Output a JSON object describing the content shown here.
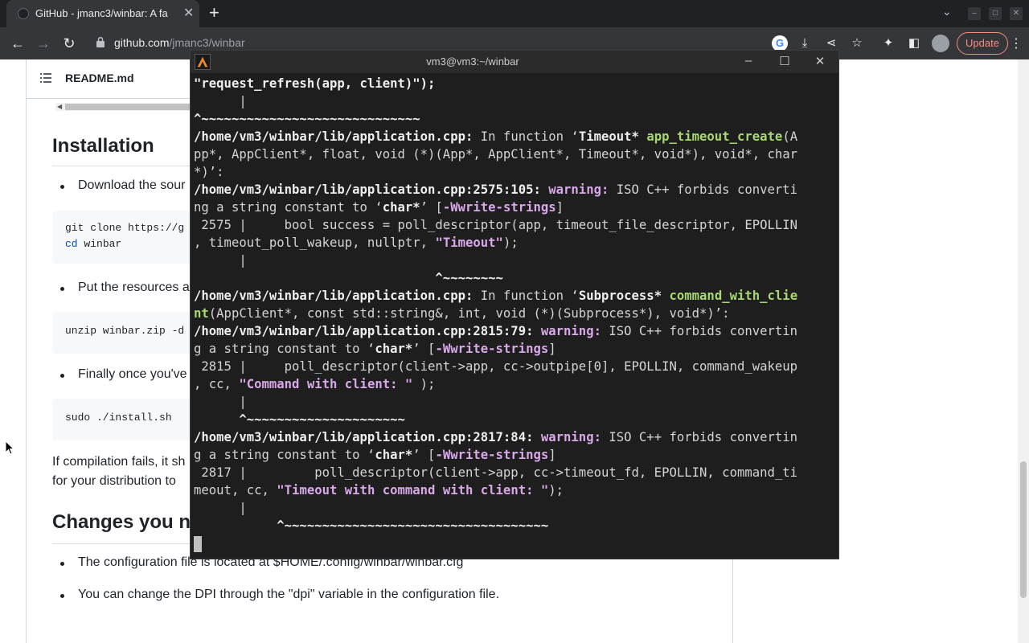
{
  "browser": {
    "tab_title": "GitHub - jmanc3/winbar: A fa",
    "url_host": "github.com",
    "url_path": "/jmanc3/winbar",
    "update_label": "Update"
  },
  "readme": {
    "file_name": "README.md",
    "installation_heading": "Installation",
    "bullet_download": "Download the sour",
    "code1_line1": "git clone https://g",
    "code1_cd": "cd",
    "code1_dir": " winbar",
    "bullet_resources": "Put the resources a",
    "code2": "unzip winbar.zip -d",
    "bullet_finally": "Finally once you've",
    "code3": "sudo ./install.sh",
    "para_line1": "If compilation fails, it sh",
    "para_line2": "for your distribution to",
    "changes_heading": "Changes you n",
    "bullet_config": "The configuration file is located at $HOME/.config/winbar/winbar.cfg",
    "bullet_dpi": "You can change the DPI through the \"dpi\" variable in the configuration file."
  },
  "terminal": {
    "title": "vm3@vm3:~/winbar",
    "l01": "\"request_refresh(app, client)\");",
    "l02": "      |",
    "l03": "^~~~~~~~~~~~~~~~~~~~~~~~~~~~~~",
    "l04a": "/home/vm3/winbar/lib/application.cpp:",
    "l04b": " In function ‘",
    "l04c": "Timeout* ",
    "l04d": "app_timeout_create",
    "l04e": "(A",
    "l05": "pp*, AppClient*, float, void (*)(App*, AppClient*, Timeout*, void*), void*, char",
    "l06": "*)’:",
    "l07a": "/home/vm3/winbar/lib/application.cpp:2575:105: ",
    "l07b": "warning: ",
    "l07c": "ISO C++ forbids converti",
    "l08a": "ng a string constant to ‘",
    "l08b": "char*",
    "l08c": "’ [",
    "l08d": "-Wwrite-strings",
    "l08e": "]",
    "l09": " 2575 |     bool success = poll_descriptor(app, timeout_file_descriptor, EPOLLIN",
    "l10a": ", timeout_poll_wakeup, nullptr, ",
    "l10b": "\"Timeout\"",
    "l10c": ");",
    "l11": "      |",
    "l12": "                                ^~~~~~~~~",
    "l13a": "/home/vm3/winbar/lib/application.cpp:",
    "l13b": " In function ‘",
    "l13c": "Subprocess* ",
    "l13d": "command_with_clie",
    "l14a": "nt",
    "l14b": "(AppClient*, const std::string&, int, void (*)(Subprocess*), void*)’:",
    "l15a": "/home/vm3/winbar/lib/application.cpp:2815:79: ",
    "l15b": "warning: ",
    "l15c": "ISO C++ forbids convertin",
    "l16a": "g a string constant to ‘",
    "l16b": "char*",
    "l16c": "’ [",
    "l16d": "-Wwrite-strings",
    "l16e": "]",
    "l17": " 2815 |     poll_descriptor(client->app, cc->outpipe[0], EPOLLIN, command_wakeup",
    "l18a": ", cc, ",
    "l18b": "\"Command with client: \"",
    "l18c": " );",
    "l19": "      |",
    "l20": "      ^~~~~~~~~~~~~~~~~~~~~~",
    "l21a": "/home/vm3/winbar/lib/application.cpp:2817:84: ",
    "l21b": "warning: ",
    "l21c": "ISO C++ forbids convertin",
    "l22a": "g a string constant to ‘",
    "l22b": "char*",
    "l22c": "’ [",
    "l22d": "-Wwrite-strings",
    "l22e": "]",
    "l23": " 2817 |         poll_descriptor(client->app, cc->timeout_fd, EPOLLIN, command_ti",
    "l24a": "meout, cc, ",
    "l24b": "\"Timeout with command with client: \"",
    "l24c": ");",
    "l25": "      |",
    "l26": "           ^~~~~~~~~~~~~~~~~~~~~~~~~~~~~~~~~~~~"
  }
}
